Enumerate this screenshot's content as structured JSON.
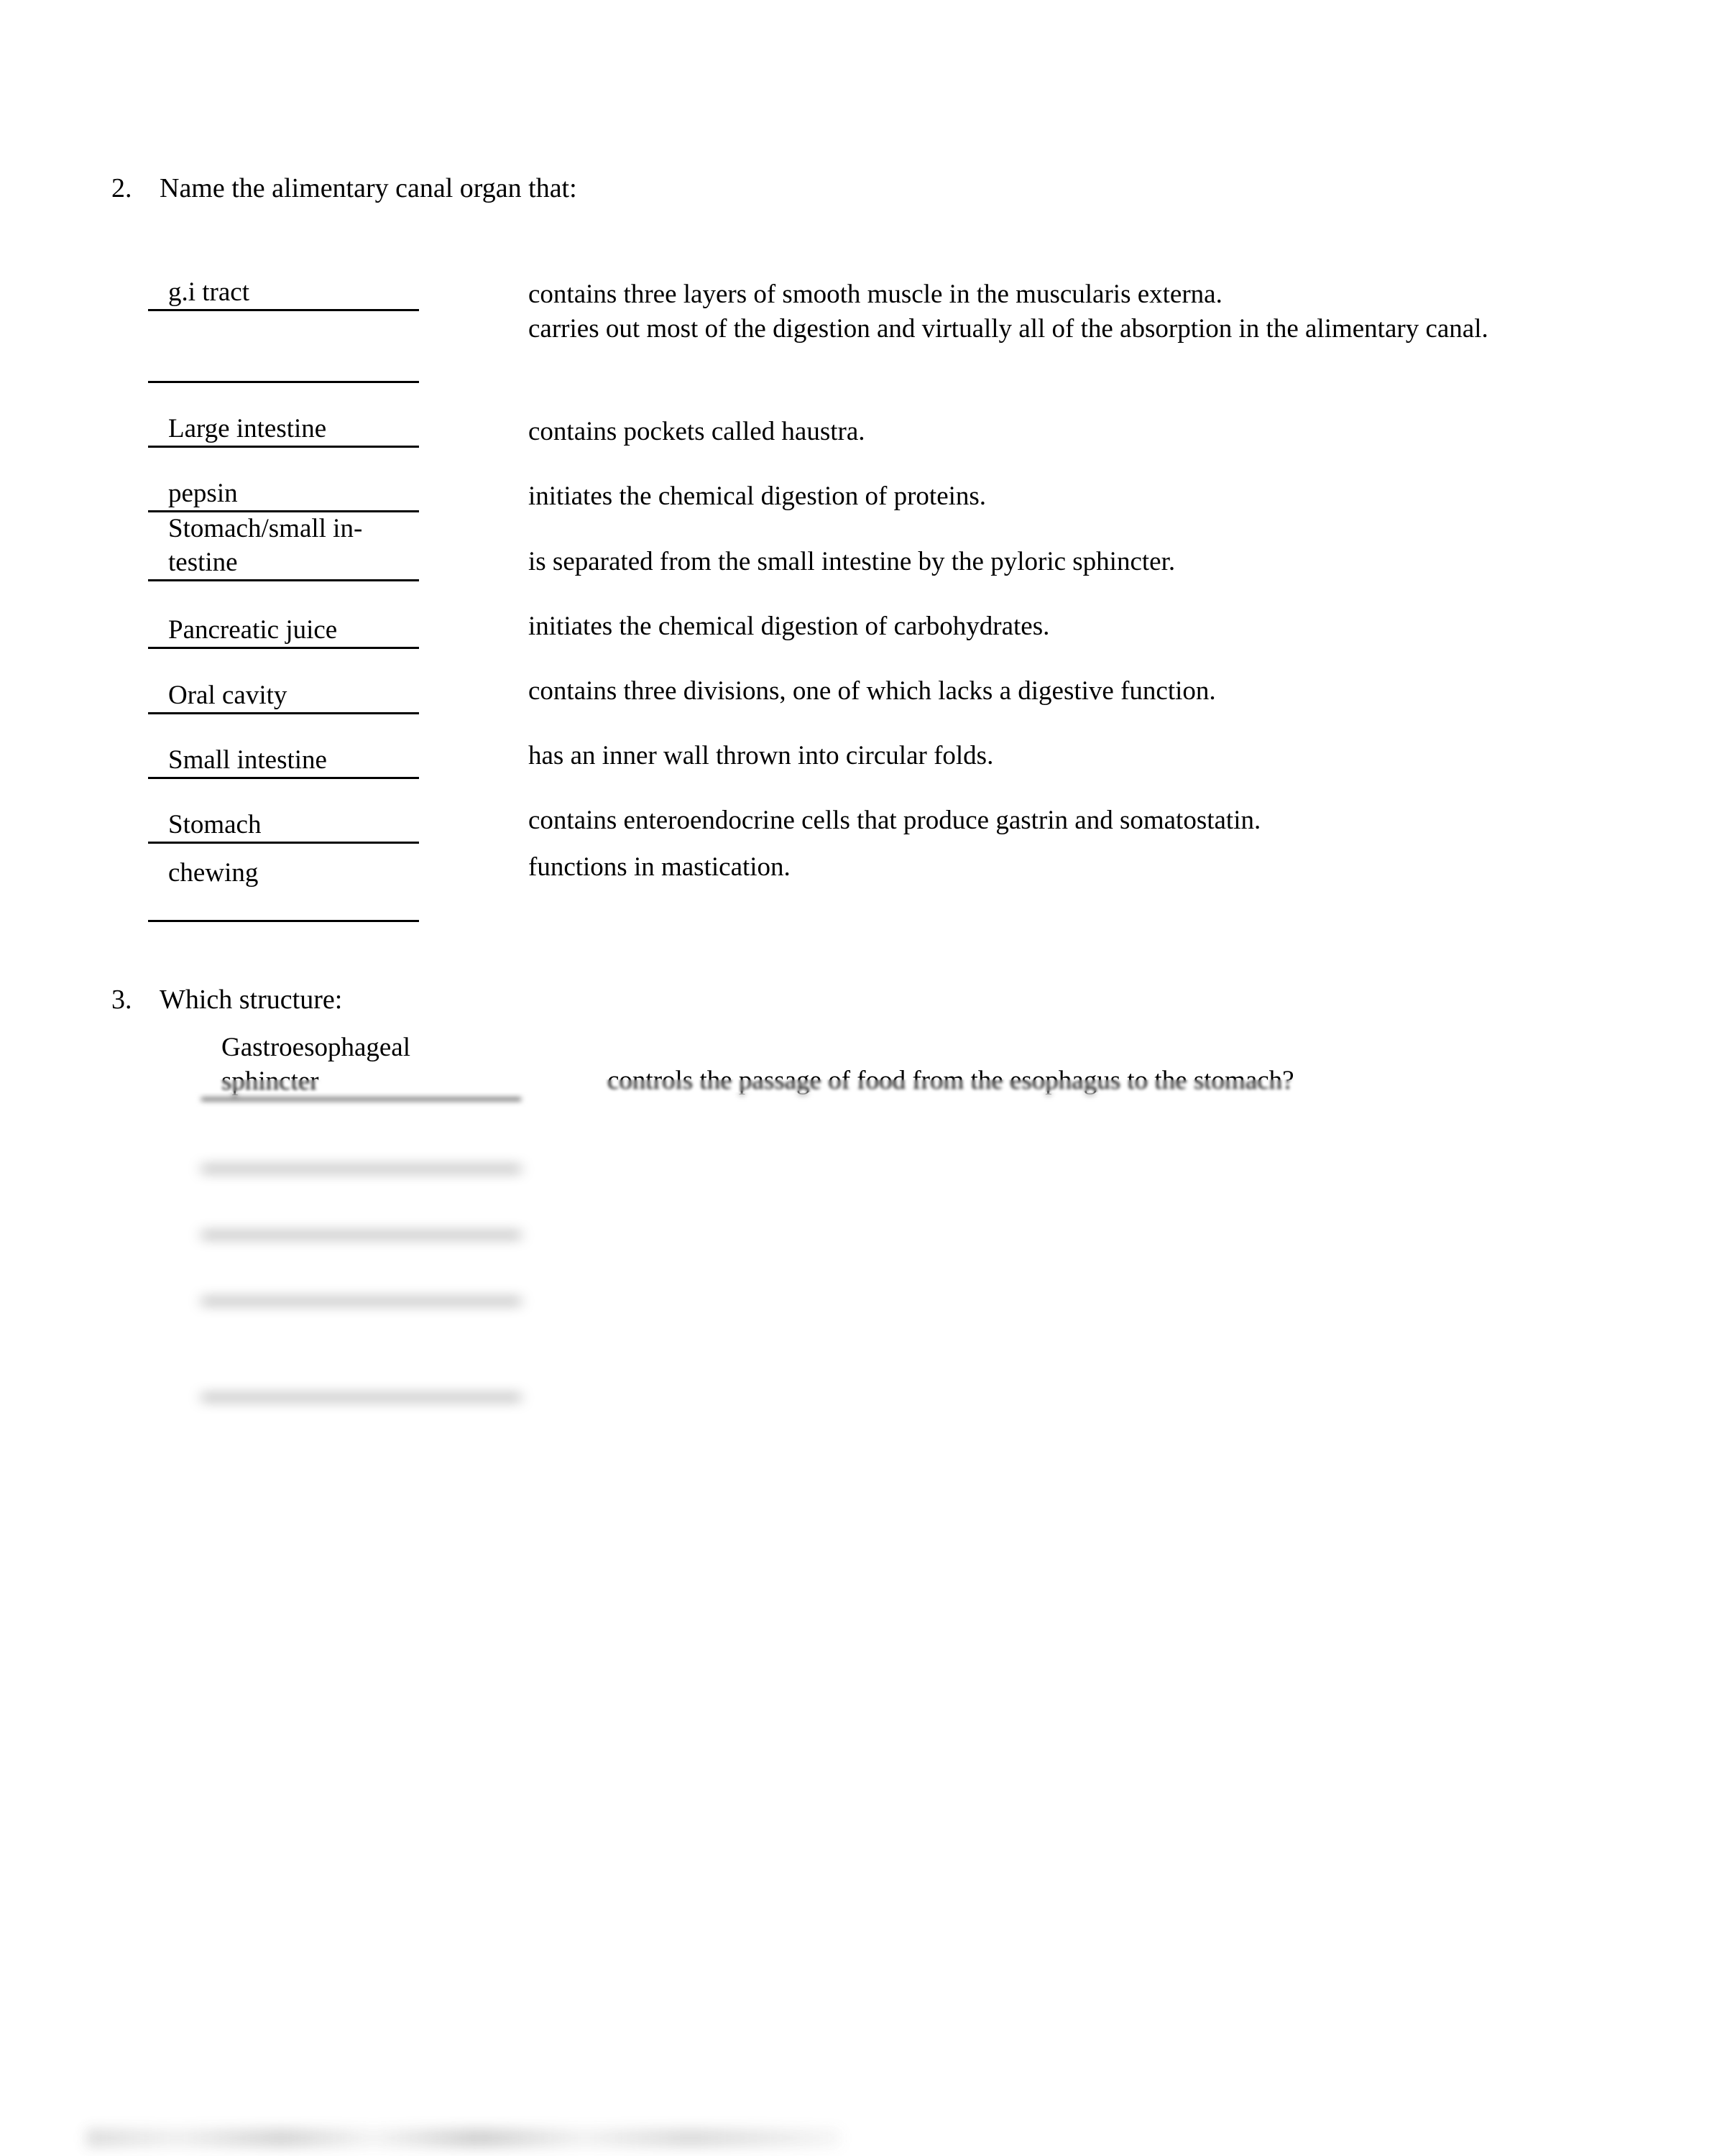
{
  "document": {
    "page_background": "#ffffff",
    "text_color": "#000000"
  },
  "questions": [
    {
      "number": "2.",
      "prompt": "Name the alimentary canal organ that:",
      "rows": [
        {
          "answer": "g.i tract",
          "description": "contains three layers of smooth muscle in the muscularis externa."
        },
        {
          "answer": "",
          "description": "carries out most of the digestion and virtually all of the absorption in the alimentary canal."
        },
        {
          "answer": "Large intestine",
          "description": "contains pockets called haustra."
        },
        {
          "answer": "pepsin",
          "description": "initiates the chemical digestion of proteins."
        },
        {
          "answer": "Stomach/small in-\ntestine",
          "description": "is separated from the small intestine by the pyloric sphincter."
        },
        {
          "answer": "Pancreatic juice",
          "description": "initiates the chemical digestion of carbohydrates."
        },
        {
          "answer": "Oral cavity",
          "description": "contains three divisions, one of which lacks a digestive function."
        },
        {
          "answer": "Small intestine",
          "description": "has an inner wall thrown into circular folds."
        },
        {
          "answer": "Stomach",
          "description": "contains enteroendocrine cells that produce gastrin and somatostatin."
        },
        {
          "answer": "chewing",
          "description": "functions in mastication."
        }
      ]
    },
    {
      "number": "3.",
      "prompt": "Which structure:",
      "rows": [
        {
          "answer": "Gastroesophageal\nsphincter",
          "description": "controls the passage of food from the esophagus to the stomach?",
          "redacted": false
        },
        {
          "answer": "",
          "description": "",
          "redacted": true
        },
        {
          "answer": "",
          "description": "",
          "redacted": true
        },
        {
          "answer": "",
          "description": "",
          "redacted": true
        },
        {
          "answer": "",
          "description": "",
          "redacted": true
        }
      ]
    }
  ]
}
